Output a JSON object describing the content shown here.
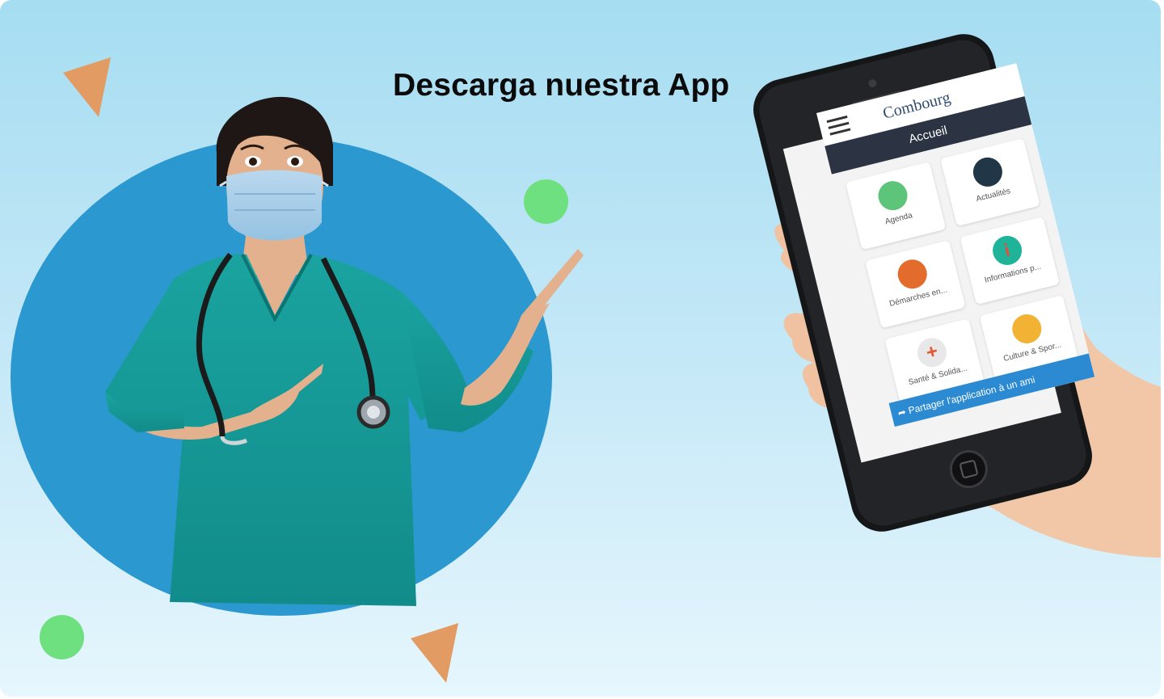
{
  "page": {
    "headline": "Descarga nuestra App",
    "colors": {
      "background_top": "#a6ddf1",
      "background_bottom": "#e6f6fd",
      "circle": "#2b98cf",
      "triangle": "#e29c63",
      "dot": "#6fe07f"
    }
  },
  "phone_screen": {
    "brand": "Combourg",
    "header": "Accueil",
    "tiles": [
      {
        "label": "Agenda",
        "icon": "calendar-icon"
      },
      {
        "label": "Actualités",
        "icon": "globe-icon"
      },
      {
        "label": "Démarches en...",
        "icon": "document-icon"
      },
      {
        "label": "Informations p...",
        "icon": "info-icon"
      },
      {
        "label": "Santé & Solida...",
        "icon": "health-cross-icon"
      },
      {
        "label": "Culture & Spor...",
        "icon": "castle-icon"
      }
    ],
    "share_bar": "Partager l'application à un ami",
    "menu_icon": "hamburger-menu-icon"
  }
}
